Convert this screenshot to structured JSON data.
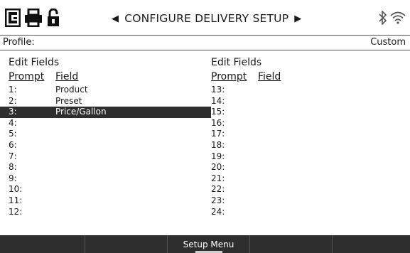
{
  "header": {
    "title": "CONFIGURE DELIVERY SETUP",
    "icons": [
      "app-logo-icon",
      "printer-icon",
      "unlocked-padlock-icon",
      "bluetooth-icon",
      "wifi-icon"
    ]
  },
  "profile": {
    "label": "Profile:",
    "value": "Custom"
  },
  "left": {
    "title": "Edit Fields",
    "prompt_header": "Prompt",
    "field_header": "Field",
    "rows": [
      {
        "num": "1:",
        "field": "Product"
      },
      {
        "num": "2:",
        "field": "Preset"
      },
      {
        "num": "3:",
        "field": "Price/Gallon"
      },
      {
        "num": "4:",
        "field": ""
      },
      {
        "num": "5:",
        "field": ""
      },
      {
        "num": "6:",
        "field": ""
      },
      {
        "num": "7:",
        "field": ""
      },
      {
        "num": "8:",
        "field": ""
      },
      {
        "num": "9:",
        "field": ""
      },
      {
        "num": "10:",
        "field": ""
      },
      {
        "num": "11:",
        "field": ""
      },
      {
        "num": "12:",
        "field": ""
      }
    ]
  },
  "right": {
    "title": "Edit Fields",
    "prompt_header": "Prompt",
    "field_header": "Field",
    "rows": [
      {
        "num": "13:",
        "field": ""
      },
      {
        "num": "14:",
        "field": ""
      },
      {
        "num": "15:",
        "field": ""
      },
      {
        "num": "16:",
        "field": ""
      },
      {
        "num": "17:",
        "field": ""
      },
      {
        "num": "18:",
        "field": ""
      },
      {
        "num": "19:",
        "field": ""
      },
      {
        "num": "20:",
        "field": ""
      },
      {
        "num": "21:",
        "field": ""
      },
      {
        "num": "22:",
        "field": ""
      },
      {
        "num": "23:",
        "field": ""
      },
      {
        "num": "24:",
        "field": ""
      }
    ]
  },
  "softkeys": [
    {
      "label": ""
    },
    {
      "label": ""
    },
    {
      "label": "Setup Menu"
    },
    {
      "label": ""
    },
    {
      "label": ""
    }
  ],
  "colors": {
    "dark": "#2e2e2e",
    "text": "#1a1a1a",
    "selected_text": "#ffffff"
  }
}
